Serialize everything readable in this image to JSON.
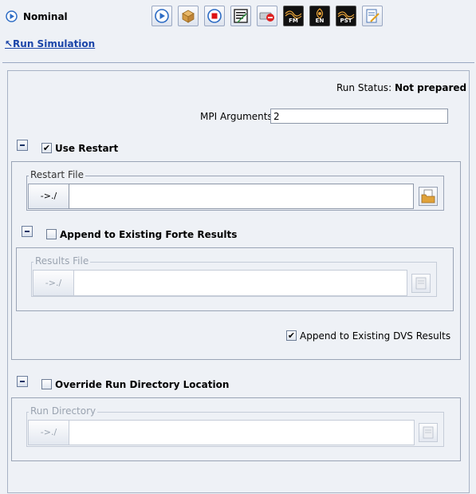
{
  "header": {
    "title": "Nominal",
    "run_link": "↖Run Simulation"
  },
  "toolbar": {
    "buttons": [
      {
        "icon": "play-icon"
      },
      {
        "icon": "package-icon"
      },
      {
        "icon": "stop-icon"
      },
      {
        "icon": "report-icon"
      },
      {
        "icon": "delete-drive-icon"
      },
      {
        "icon": "fm-icon",
        "label": "FM"
      },
      {
        "icon": "en-icon",
        "label": "EN"
      },
      {
        "icon": "pst-icon",
        "label": "PST"
      },
      {
        "icon": "edit-icon"
      }
    ]
  },
  "run_status": {
    "label": "Run Status:",
    "value": "Not prepared"
  },
  "mpi": {
    "label": "MPI Arguments",
    "value": "2"
  },
  "restart": {
    "label": "Use Restart",
    "checked": true,
    "file_legend": "Restart File",
    "dir_button": "->./",
    "path": ""
  },
  "append_forte": {
    "label": "Append to Existing Forte Results",
    "checked": false,
    "file_legend": "Results File",
    "dir_button": "->./",
    "path": ""
  },
  "append_dvs": {
    "label": "Append to Existing DVS Results",
    "checked": true
  },
  "override": {
    "label": "Override Run Directory Location",
    "checked": false,
    "dir_legend": "Run Directory",
    "dir_button": "->./",
    "path": ""
  },
  "check_mark": "✔",
  "colors": {
    "background": "#eef1f6",
    "link": "#1a44a8",
    "border": "#9aa4b6"
  }
}
